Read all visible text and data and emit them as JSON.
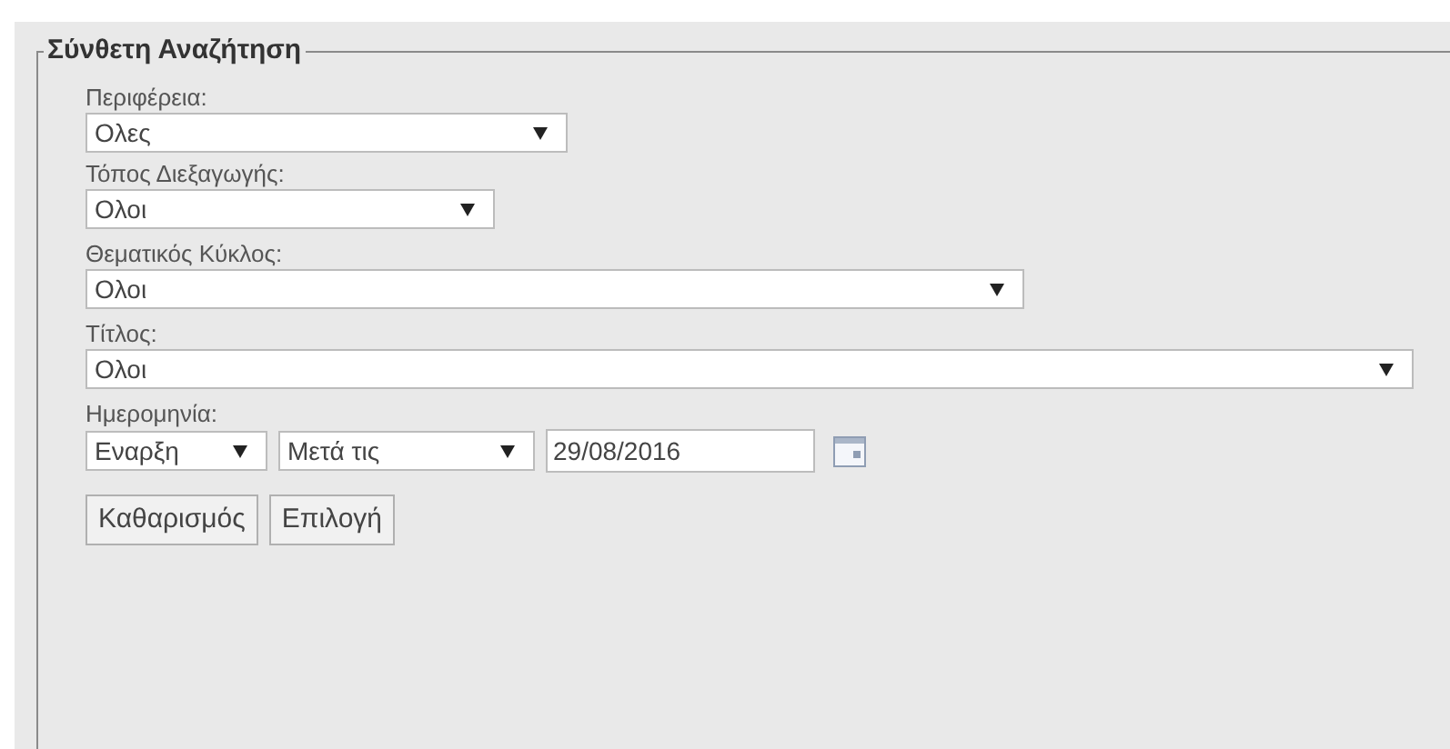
{
  "legend": "Σύνθετη Αναζήτηση",
  "fields": [
    {
      "label": "Περιφέρεια:",
      "value": "Ολες"
    },
    {
      "label": "Τόπος Διεξαγωγής:",
      "value": "Ολοι"
    },
    {
      "label": "Θεματικός Κύκλος:",
      "value": "Ολοι"
    },
    {
      "label": "Τίτλος:",
      "value": "Ολοι"
    }
  ],
  "date": {
    "label": "Ημερομηνία:",
    "controls": [
      {
        "kind": "select",
        "value": "Εναρξη"
      },
      {
        "kind": "select",
        "value": "Μετά τις"
      },
      {
        "kind": "date",
        "value": "29/08/2016"
      }
    ]
  },
  "buttons": [
    "Καθαρισμός",
    "Επιλογή"
  ]
}
